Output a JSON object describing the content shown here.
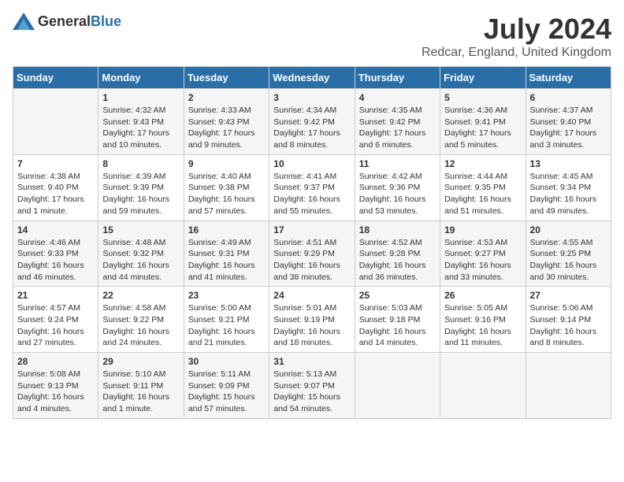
{
  "header": {
    "logo_general": "General",
    "logo_blue": "Blue",
    "month": "July 2024",
    "location": "Redcar, England, United Kingdom"
  },
  "days_of_week": [
    "Sunday",
    "Monday",
    "Tuesday",
    "Wednesday",
    "Thursday",
    "Friday",
    "Saturday"
  ],
  "weeks": [
    [
      {
        "day": "",
        "text": ""
      },
      {
        "day": "1",
        "text": "Sunrise: 4:32 AM\nSunset: 9:43 PM\nDaylight: 17 hours\nand 10 minutes."
      },
      {
        "day": "2",
        "text": "Sunrise: 4:33 AM\nSunset: 9:43 PM\nDaylight: 17 hours\nand 9 minutes."
      },
      {
        "day": "3",
        "text": "Sunrise: 4:34 AM\nSunset: 9:42 PM\nDaylight: 17 hours\nand 8 minutes."
      },
      {
        "day": "4",
        "text": "Sunrise: 4:35 AM\nSunset: 9:42 PM\nDaylight: 17 hours\nand 6 minutes."
      },
      {
        "day": "5",
        "text": "Sunrise: 4:36 AM\nSunset: 9:41 PM\nDaylight: 17 hours\nand 5 minutes."
      },
      {
        "day": "6",
        "text": "Sunrise: 4:37 AM\nSunset: 9:40 PM\nDaylight: 17 hours\nand 3 minutes."
      }
    ],
    [
      {
        "day": "7",
        "text": "Sunrise: 4:38 AM\nSunset: 9:40 PM\nDaylight: 17 hours\nand 1 minute."
      },
      {
        "day": "8",
        "text": "Sunrise: 4:39 AM\nSunset: 9:39 PM\nDaylight: 16 hours\nand 59 minutes."
      },
      {
        "day": "9",
        "text": "Sunrise: 4:40 AM\nSunset: 9:38 PM\nDaylight: 16 hours\nand 57 minutes."
      },
      {
        "day": "10",
        "text": "Sunrise: 4:41 AM\nSunset: 9:37 PM\nDaylight: 16 hours\nand 55 minutes."
      },
      {
        "day": "11",
        "text": "Sunrise: 4:42 AM\nSunset: 9:36 PM\nDaylight: 16 hours\nand 53 minutes."
      },
      {
        "day": "12",
        "text": "Sunrise: 4:44 AM\nSunset: 9:35 PM\nDaylight: 16 hours\nand 51 minutes."
      },
      {
        "day": "13",
        "text": "Sunrise: 4:45 AM\nSunset: 9:34 PM\nDaylight: 16 hours\nand 49 minutes."
      }
    ],
    [
      {
        "day": "14",
        "text": "Sunrise: 4:46 AM\nSunset: 9:33 PM\nDaylight: 16 hours\nand 46 minutes."
      },
      {
        "day": "15",
        "text": "Sunrise: 4:48 AM\nSunset: 9:32 PM\nDaylight: 16 hours\nand 44 minutes."
      },
      {
        "day": "16",
        "text": "Sunrise: 4:49 AM\nSunset: 9:31 PM\nDaylight: 16 hours\nand 41 minutes."
      },
      {
        "day": "17",
        "text": "Sunrise: 4:51 AM\nSunset: 9:29 PM\nDaylight: 16 hours\nand 38 minutes."
      },
      {
        "day": "18",
        "text": "Sunrise: 4:52 AM\nSunset: 9:28 PM\nDaylight: 16 hours\nand 36 minutes."
      },
      {
        "day": "19",
        "text": "Sunrise: 4:53 AM\nSunset: 9:27 PM\nDaylight: 16 hours\nand 33 minutes."
      },
      {
        "day": "20",
        "text": "Sunrise: 4:55 AM\nSunset: 9:25 PM\nDaylight: 16 hours\nand 30 minutes."
      }
    ],
    [
      {
        "day": "21",
        "text": "Sunrise: 4:57 AM\nSunset: 9:24 PM\nDaylight: 16 hours\nand 27 minutes."
      },
      {
        "day": "22",
        "text": "Sunrise: 4:58 AM\nSunset: 9:22 PM\nDaylight: 16 hours\nand 24 minutes."
      },
      {
        "day": "23",
        "text": "Sunrise: 5:00 AM\nSunset: 9:21 PM\nDaylight: 16 hours\nand 21 minutes."
      },
      {
        "day": "24",
        "text": "Sunrise: 5:01 AM\nSunset: 9:19 PM\nDaylight: 16 hours\nand 18 minutes."
      },
      {
        "day": "25",
        "text": "Sunrise: 5:03 AM\nSunset: 9:18 PM\nDaylight: 16 hours\nand 14 minutes."
      },
      {
        "day": "26",
        "text": "Sunrise: 5:05 AM\nSunset: 9:16 PM\nDaylight: 16 hours\nand 11 minutes."
      },
      {
        "day": "27",
        "text": "Sunrise: 5:06 AM\nSunset: 9:14 PM\nDaylight: 16 hours\nand 8 minutes."
      }
    ],
    [
      {
        "day": "28",
        "text": "Sunrise: 5:08 AM\nSunset: 9:13 PM\nDaylight: 16 hours\nand 4 minutes."
      },
      {
        "day": "29",
        "text": "Sunrise: 5:10 AM\nSunset: 9:11 PM\nDaylight: 16 hours\nand 1 minute."
      },
      {
        "day": "30",
        "text": "Sunrise: 5:11 AM\nSunset: 9:09 PM\nDaylight: 15 hours\nand 57 minutes."
      },
      {
        "day": "31",
        "text": "Sunrise: 5:13 AM\nSunset: 9:07 PM\nDaylight: 15 hours\nand 54 minutes."
      },
      {
        "day": "",
        "text": ""
      },
      {
        "day": "",
        "text": ""
      },
      {
        "day": "",
        "text": ""
      }
    ]
  ]
}
